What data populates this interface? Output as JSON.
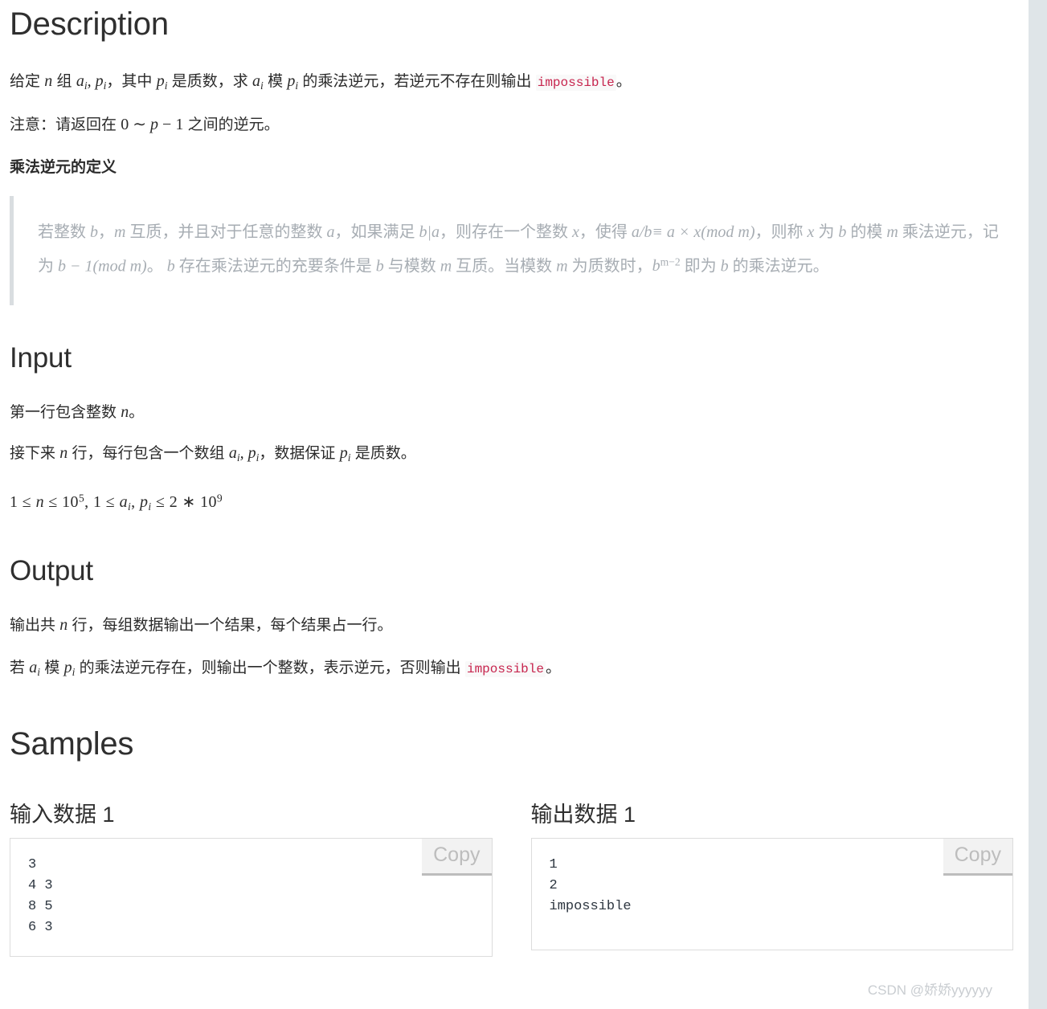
{
  "sections": {
    "description": {
      "heading": "Description",
      "para1": {
        "pre": "给定 ",
        "var_n": "n",
        "mid1": " 组 ",
        "var_aipi": "a_i, p_i",
        "mid2": "，其中 ",
        "var_pi": "p_i",
        "mid3": " 是质数，求 ",
        "var_ai": "a_i",
        "mid4": " 模 ",
        "var_pi2": "p_i",
        "mid5": " 的乘法逆元，若逆元不存在则输出 ",
        "code": "impossible",
        "tail": "。"
      },
      "para2": {
        "pre": "注意：请返回在 ",
        "formula": "0 ~ p - 1",
        "tail": " 之间的逆元。"
      },
      "subheading": "乘法逆元的定义",
      "quote": {
        "line1_pre": "若整数 ",
        "b1": "b",
        "comma1": "，",
        "m1": "m",
        "t1": " 互质，并且对于任意的整数 ",
        "a1": "a",
        "t2": "，如果满足 ",
        "bdiva": "b|a",
        "t3": "，则存在一个整数 ",
        "x1": "x",
        "t4": "，使得 ",
        "eq1": "a/b≡ a × x(mod m)",
        "t5": "，则称 ",
        "x2": "x",
        "t6": " 为 ",
        "b2": "b",
        "t7": " 的模 ",
        "m2": "m",
        "t8": " 乘法逆元，记为 ",
        "eq2": "b − 1(mod m)",
        "t9": "。 ",
        "b3": "b",
        "t10": " 存在乘法逆元的充要条件是 ",
        "b4": "b",
        "t11": " 与模数 ",
        "m3": "m",
        "t12": " 互质。当模数 ",
        "m4": "m",
        "t13": " 为质数时，",
        "eq3": "b^(m−2)",
        "t14": " 即为 ",
        "b5": "b",
        "t15": " 的乘法逆元。"
      }
    },
    "input": {
      "heading": "Input",
      "para1": {
        "pre": "第一行包含整数 ",
        "var_n": "n",
        "tail": "。"
      },
      "para2": {
        "pre": "接下来 ",
        "var_n": "n",
        "mid1": " 行，每行包含一个数组 ",
        "var_aipi": "a_i, p_i",
        "mid2": "，数据保证 ",
        "var_pi": "p_i",
        "tail": " 是质数。"
      },
      "constraint": "1 ≤ n ≤ 10^5, 1 ≤ a_i, p_i ≤ 2 * 10^9"
    },
    "output": {
      "heading": "Output",
      "para1": {
        "pre": "输出共 ",
        "var_n": "n",
        "tail": " 行，每组数据输出一个结果，每个结果占一行。"
      },
      "para2": {
        "pre": "若 ",
        "var_ai": "a_i",
        "mid1": " 模 ",
        "var_pi": "p_i",
        "mid2": " 的乘法逆元存在，则输出一个整数，表示逆元，否则输出 ",
        "code": "impossible",
        "tail": "。"
      }
    },
    "samples": {
      "heading": "Samples",
      "input_sample": {
        "title": "输入数据 1",
        "copy_label": "Copy",
        "content": "3\n4 3\n8 5\n6 3"
      },
      "output_sample": {
        "title": "输出数据 1",
        "copy_label": "Copy",
        "content": "1\n2\nimpossible"
      }
    }
  },
  "watermark": "CSDN @娇娇yyyyyy",
  "colors": {
    "code_red": "#c7254e",
    "heading": "#2f2f2f",
    "quote_text": "#a7adb3",
    "quote_border": "#d9dde0",
    "box_border": "#dcdcdc",
    "copy_bg": "#f2f2f2",
    "copy_text": "#bdbdbd",
    "watermark": "#c9cdd1",
    "gutter": "#dfe5e8"
  }
}
